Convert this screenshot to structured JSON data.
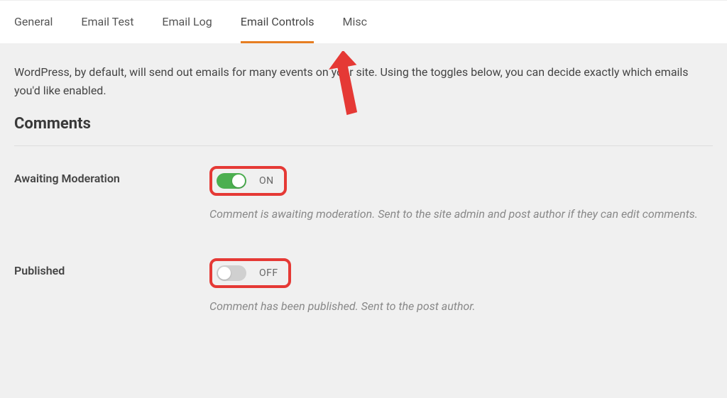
{
  "tabs": {
    "items": [
      {
        "label": "General"
      },
      {
        "label": "Email Test"
      },
      {
        "label": "Email Log"
      },
      {
        "label": "Email Controls"
      },
      {
        "label": "Misc"
      }
    ],
    "activeIndex": 3
  },
  "intro": "WordPress, by default, will send out emails for many events on your site. Using the toggles below, you can decide exactly which emails you'd like enabled.",
  "section": {
    "title": "Comments",
    "settings": [
      {
        "label": "Awaiting Moderation",
        "state": "ON",
        "on": true,
        "description": "Comment is awaiting moderation. Sent to the site admin and post author if they can edit comments."
      },
      {
        "label": "Published",
        "state": "OFF",
        "on": false,
        "description": "Comment has been published. Sent to the post author."
      }
    ]
  },
  "colors": {
    "accent": "#e67e22",
    "highlight": "#e53935",
    "toggleOn": "#4CAF50"
  }
}
